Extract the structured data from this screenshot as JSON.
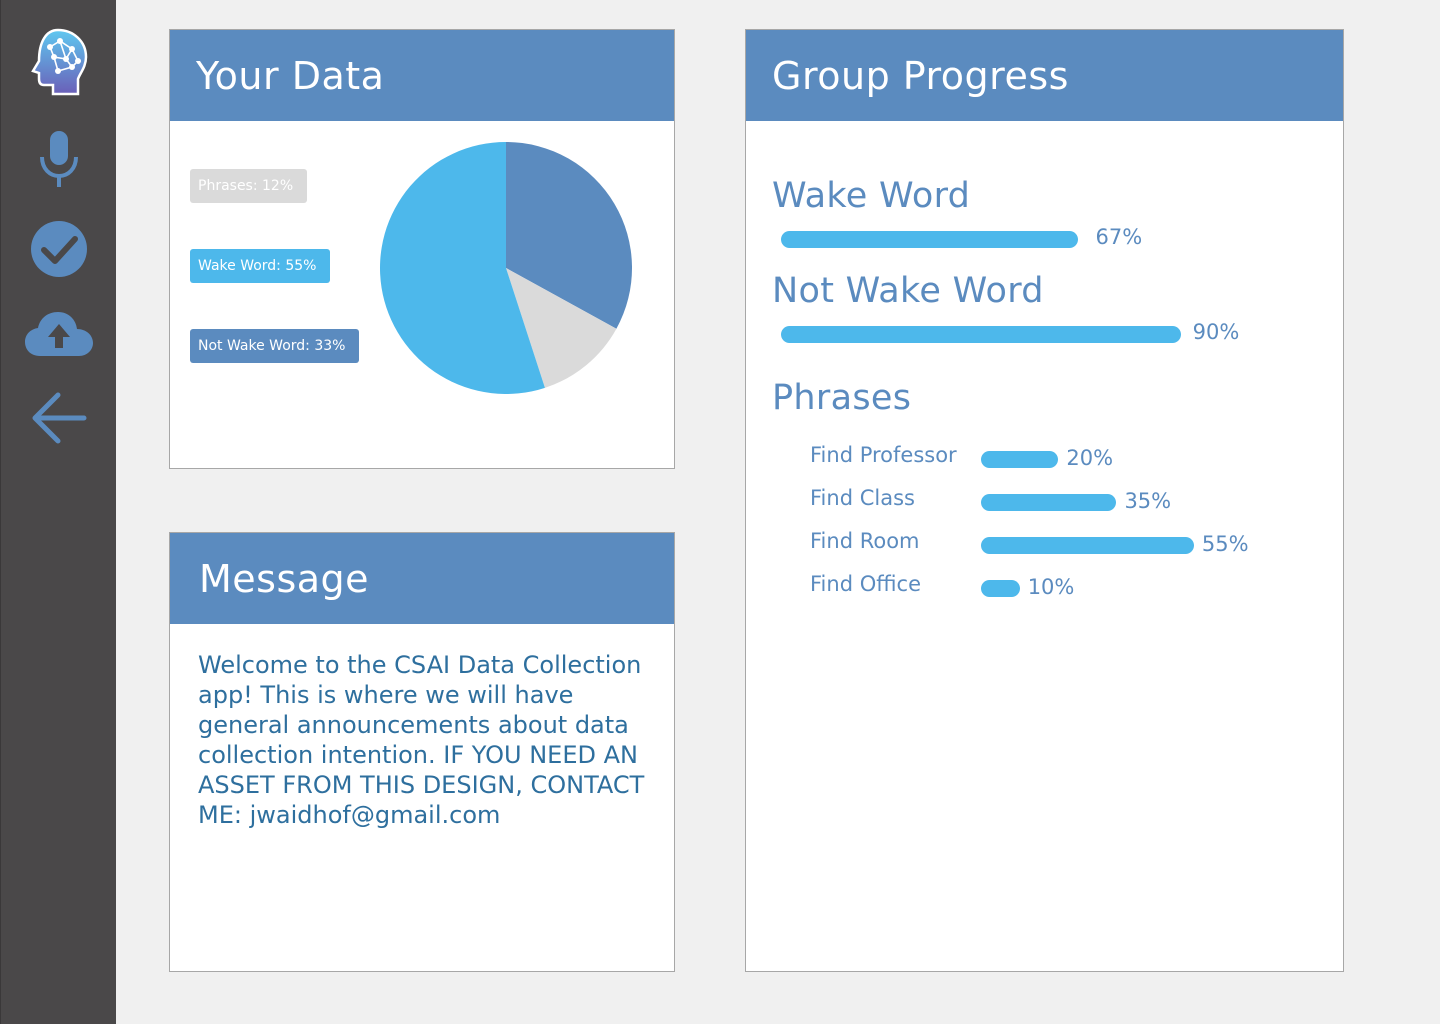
{
  "sidebar": {
    "icons": [
      "brain-logo-icon",
      "microphone-icon",
      "check-circle-icon",
      "cloud-upload-icon",
      "arrow-left-icon"
    ]
  },
  "your_data": {
    "title": "Your Data",
    "legend": [
      {
        "label": "Phrases: 12%",
        "color": "#dadada",
        "text_color": "#ffffff"
      },
      {
        "label": "Wake Word: 55%",
        "color": "#4db8eb",
        "text_color": "#ffffff"
      },
      {
        "label": "Not Wake Word: 33%",
        "color": "#5b8bbf",
        "text_color": "#ffffff"
      }
    ],
    "chart_data": {
      "type": "pie",
      "slices": [
        {
          "category": "Not Wake Word",
          "value": 33,
          "color": "#5b8bbf"
        },
        {
          "category": "Phrases",
          "value": 12,
          "color": "#dadada"
        },
        {
          "category": "Wake Word",
          "value": 55,
          "color": "#4db8eb"
        }
      ]
    }
  },
  "message": {
    "title": "Message",
    "body": "Welcome to the CSAI Data Collection app! This is where we will have general announcements about data collection intention. IF YOU NEED AN ASSET FROM THIS DESIGN, CONTACT ME: jwaidhof@gmail.com"
  },
  "group_progress": {
    "title": "Group Progress",
    "wake_word": {
      "label": "Wake Word",
      "value": 67,
      "pct_label": "67%"
    },
    "not_wake_word": {
      "label": "Not Wake Word",
      "value": 90,
      "pct_label": "90%"
    },
    "phrases": {
      "label": "Phrases",
      "items": [
        {
          "label": "Find Professor",
          "value": 20,
          "pct_label": "20%"
        },
        {
          "label": "Find Class",
          "value": 35,
          "pct_label": "35%"
        },
        {
          "label": "Find Room",
          "value": 55,
          "pct_label": "55%"
        },
        {
          "label": "Find Office",
          "value": 10,
          "pct_label": "10%"
        }
      ]
    }
  },
  "colors": {
    "accent": "#5b8bbf",
    "bar": "#4db8eb",
    "sidebar": "#4a4849"
  }
}
